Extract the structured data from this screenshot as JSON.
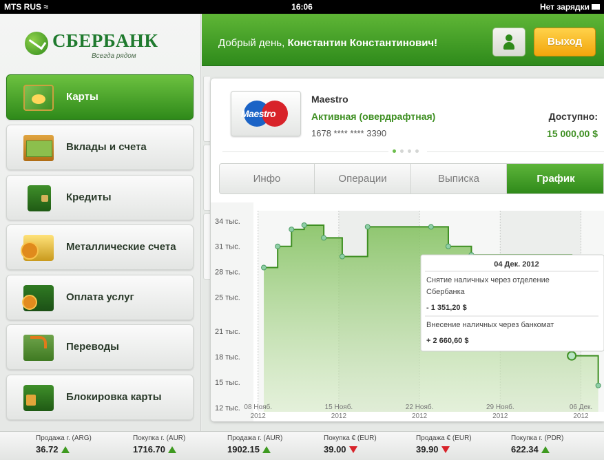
{
  "status_bar": {
    "carrier": "MTS RUS",
    "time": "16:06",
    "battery": "Нет зарядки"
  },
  "brand": {
    "name": "СБЕРБАНК",
    "tagline": "Всегда рядом"
  },
  "header": {
    "greeting": "Добрый день,",
    "user_name": "Константин Константинович!",
    "logout_label": "Выход"
  },
  "menu": [
    {
      "label": "Карты",
      "icon": "card-icon",
      "active": true
    },
    {
      "label": "Вклады и счета",
      "icon": "deposit-icon",
      "active": false
    },
    {
      "label": "Кредиты",
      "icon": "wallet-icon",
      "active": false
    },
    {
      "label": "Металлические счета",
      "icon": "gold-icon",
      "active": false
    },
    {
      "label": "Оплата услуг",
      "icon": "payment-icon",
      "active": false
    },
    {
      "label": "Переводы",
      "icon": "transfer-icon",
      "active": false
    },
    {
      "label": "Блокировка карты",
      "icon": "lock-icon",
      "active": false
    }
  ],
  "card": {
    "logo_text": "Maestro",
    "name": "Maestro",
    "status": "Активная (овердрафтная)",
    "number": "1678 **** **** 3390",
    "available_label": "Доступно:",
    "available_value": "15 000,00 $",
    "pager_current": 1,
    "pager_total": 4
  },
  "tabs": [
    {
      "label": "Инфо",
      "active": false
    },
    {
      "label": "Операции",
      "active": false
    },
    {
      "label": "Выписка",
      "active": false
    },
    {
      "label": "График",
      "active": true
    }
  ],
  "chart_data": {
    "type": "area",
    "y_ticks": [
      "34 тыс.",
      "31 тыс.",
      "28 тыс.",
      "25 тыс.",
      "21 тыс.",
      "18 тыс.",
      "15 тыс.",
      "12 тыс."
    ],
    "y_tick_values": [
      34,
      31,
      28,
      25,
      21,
      18,
      15,
      12
    ],
    "x_ticks": [
      {
        "day": "08 Нояб.",
        "year": "2012",
        "x": 8
      },
      {
        "day": "15 Нояб.",
        "year": "2012",
        "x": 15
      },
      {
        "day": "22 Нояб.",
        "year": "2012",
        "x": 22
      },
      {
        "day": "29 Нояб.",
        "year": "2012",
        "x": 29
      },
      {
        "day": "06 Дек.",
        "year": "2012",
        "x": 36
      }
    ],
    "series": [
      {
        "points": [
          [
            8.5,
            28.5
          ],
          [
            9.7,
            31.0
          ],
          [
            10.9,
            33.0
          ],
          [
            12.0,
            33.5
          ],
          [
            13.7,
            32.0
          ],
          [
            15.3,
            29.8
          ],
          [
            17.5,
            33.3
          ],
          [
            23.0,
            33.3
          ],
          [
            24.5,
            31.0
          ],
          [
            26.5,
            30.0
          ],
          [
            35.2,
            18.1
          ],
          [
            37.5,
            14.6
          ]
        ],
        "color": "#3e8f22"
      }
    ],
    "highlight_point": [
      35.2,
      18.1
    ],
    "tooltip": {
      "date": "04 Дек. 2012",
      "entries": [
        {
          "description": "Снятие наличных через отделение Сбербанка",
          "amount": "- 1 351,20 $"
        },
        {
          "description": "Внесение наличных через банкомат",
          "amount": "+ 2 660,60 $"
        }
      ]
    }
  },
  "ticker": [
    {
      "label": "Продажа г. (ARG)",
      "value": "36.72",
      "trend": "up"
    },
    {
      "label": "Покупка г. (AUR)",
      "value": "1716.70",
      "trend": "up"
    },
    {
      "label": "Продажа г. (AUR)",
      "value": "1902.15",
      "trend": "up"
    },
    {
      "label": "Покупка € (EUR)",
      "value": "39.00",
      "trend": "down"
    },
    {
      "label": "Продажа € (EUR)",
      "value": "39.90",
      "trend": "down"
    },
    {
      "label": "Покупка г. (PDR)",
      "value": "622.34",
      "trend": "up"
    }
  ],
  "colors": {
    "brand_green": "#3e8f22",
    "accent_orange": "#f2a50c",
    "down_red": "#d8232a"
  }
}
